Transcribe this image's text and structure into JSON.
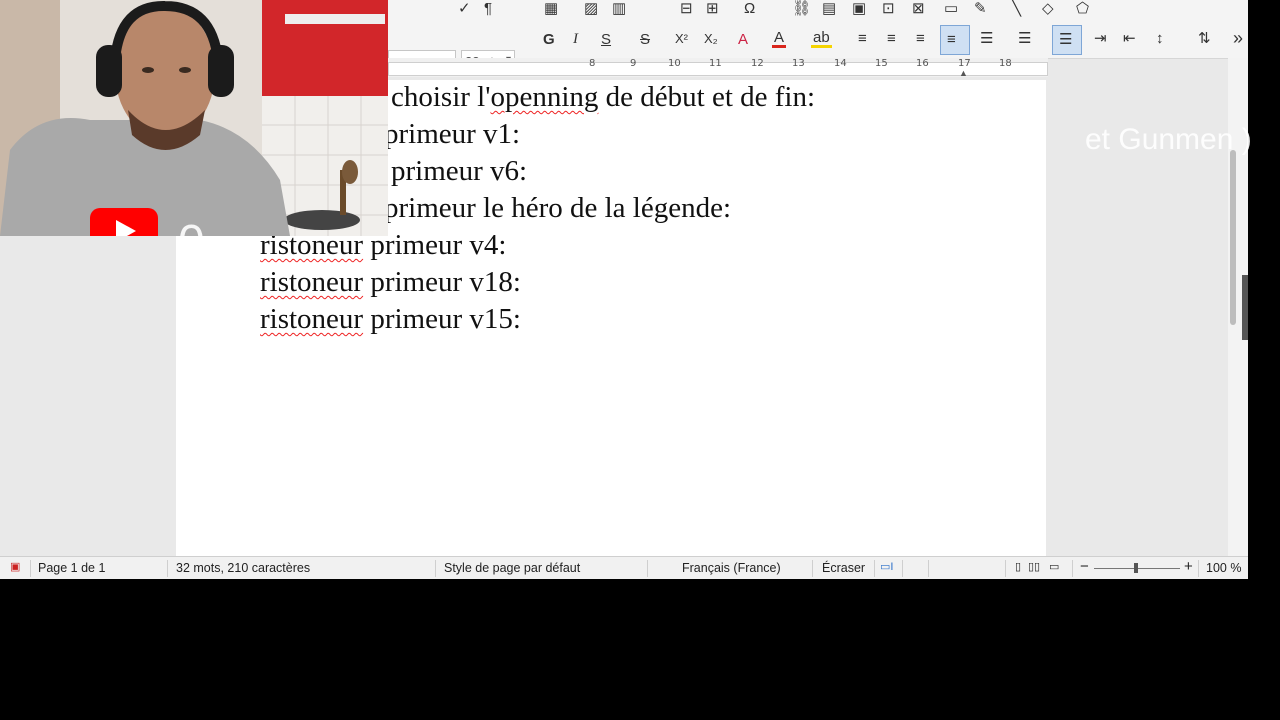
{
  "toolbar": {
    "font_size_value": "22 pt",
    "bold_label": "G",
    "italic_label": "I",
    "underline_label": "S",
    "strike_label": "S",
    "superscript_label": "X²",
    "subscript_label": "X₂",
    "more_label": "»"
  },
  "ruler": {
    "numbers": [
      "8",
      "9",
      "10",
      "11",
      "12",
      "13",
      "14",
      "15",
      "16",
      "17",
      "18"
    ]
  },
  "document": {
    "lines": [
      "choisir l'openning de début et de fin:",
      "primeur v1:",
      "primeur v6:",
      "primeur le héro de la légende:",
      "ristoneur primeur v4:",
      "ristoneur primeur v18:",
      "ristoneur primeur v15:"
    ],
    "misspelled": [
      "openning",
      "ristoneur",
      "ristoneur",
      "ristoneur"
    ]
  },
  "overlay": {
    "right_text": "et Gunmen )"
  },
  "status": {
    "page": "Page 1 de 1",
    "words": "32 mots, 210 caractères",
    "page_style": "Style de page par défaut",
    "language": "Français (France)",
    "insert_mode": "Écraser",
    "zoom": "100 %"
  },
  "colors": {
    "font_color": "#d9261c",
    "highlight_color": "#f5d400",
    "spellcheck_underline": "#e22222",
    "youtube_red": "#ff0000"
  }
}
